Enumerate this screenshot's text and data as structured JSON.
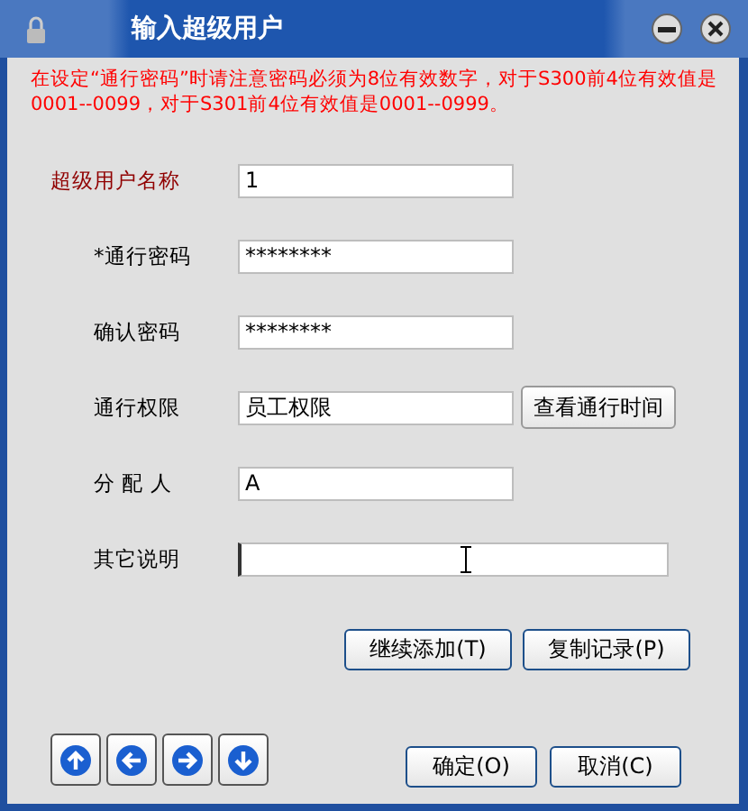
{
  "window": {
    "title": "输入超级用户"
  },
  "notice": "在设定“通行密码”时请注意密码必须为8位有效数字，对于S300前4位有效值是0001--0099，对于S301前4位有效值是0001--0999。",
  "fields": [
    {
      "label": "超级用户名称",
      "value": "1",
      "emphasized": true,
      "kind": "short",
      "focused": false
    },
    {
      "label": "*通行密码",
      "value": "********",
      "emphasized": false,
      "kind": "short",
      "focused": false
    },
    {
      "label": "确认密码",
      "value": "********",
      "emphasized": false,
      "kind": "short",
      "focused": false
    },
    {
      "label": "通行权限",
      "value": "员工权限",
      "emphasized": false,
      "kind": "short",
      "focused": false,
      "button": "查看通行时间"
    },
    {
      "label": "分 配 人",
      "value": "A",
      "emphasized": false,
      "kind": "short",
      "focused": false
    },
    {
      "label": "其它说明",
      "emphasized": false,
      "kind": "long",
      "focused": true
    }
  ],
  "record_buttons": [
    "继续添加(T)",
    "复制记录(P)"
  ],
  "nav_buttons": [
    {
      "kind": "up"
    },
    {
      "kind": "left"
    },
    {
      "kind": "right"
    },
    {
      "kind": "down"
    }
  ],
  "dialog_buttons": [
    "确定(O)",
    "取消(C)"
  ]
}
